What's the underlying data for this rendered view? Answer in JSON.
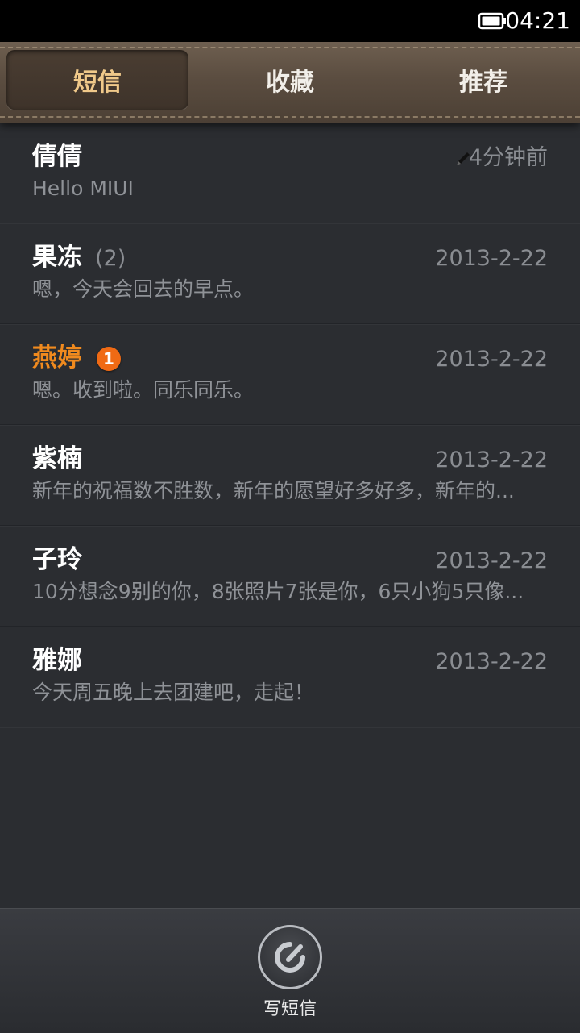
{
  "status_bar": {
    "time": "04:21",
    "battery_icon": "battery-full-icon"
  },
  "tabs": [
    {
      "label": "短信",
      "active": true
    },
    {
      "label": "收藏",
      "active": false
    },
    {
      "label": "推荐",
      "active": false
    }
  ],
  "threads": [
    {
      "name": "倩倩",
      "count": "",
      "unread_badge": "",
      "date": "4分钟前",
      "draft_icon": "pencil-icon",
      "preview": "Hello MIUI"
    },
    {
      "name": "果冻",
      "count": "(2)",
      "unread_badge": "",
      "date": "2013-2-22",
      "preview": "嗯，今天会回去的早点。"
    },
    {
      "name": "燕婷",
      "count": "",
      "unread_badge": "1",
      "date": "2013-2-22",
      "preview": "嗯。收到啦。同乐同乐。"
    },
    {
      "name": "紫楠",
      "count": "",
      "unread_badge": "",
      "date": "2013-2-22",
      "preview": "新年的祝福数不胜数，新年的愿望好多好多，新年的..."
    },
    {
      "name": "子玲",
      "count": "",
      "unread_badge": "",
      "date": "2013-2-22",
      "preview": "10分想念9别的你，8张照片7张是你，6只小狗5只像..."
    },
    {
      "name": "雅娜",
      "count": "",
      "unread_badge": "",
      "date": "2013-2-22",
      "preview": "今天周五晚上去团建吧，走起！"
    }
  ],
  "bottom_bar": {
    "compose_label": "写短信",
    "compose_icon": "compose-icon"
  },
  "colors": {
    "accent_unread": "#f08a1e",
    "active_tab_text": "#f0c98a",
    "badge": "#f06a14"
  }
}
